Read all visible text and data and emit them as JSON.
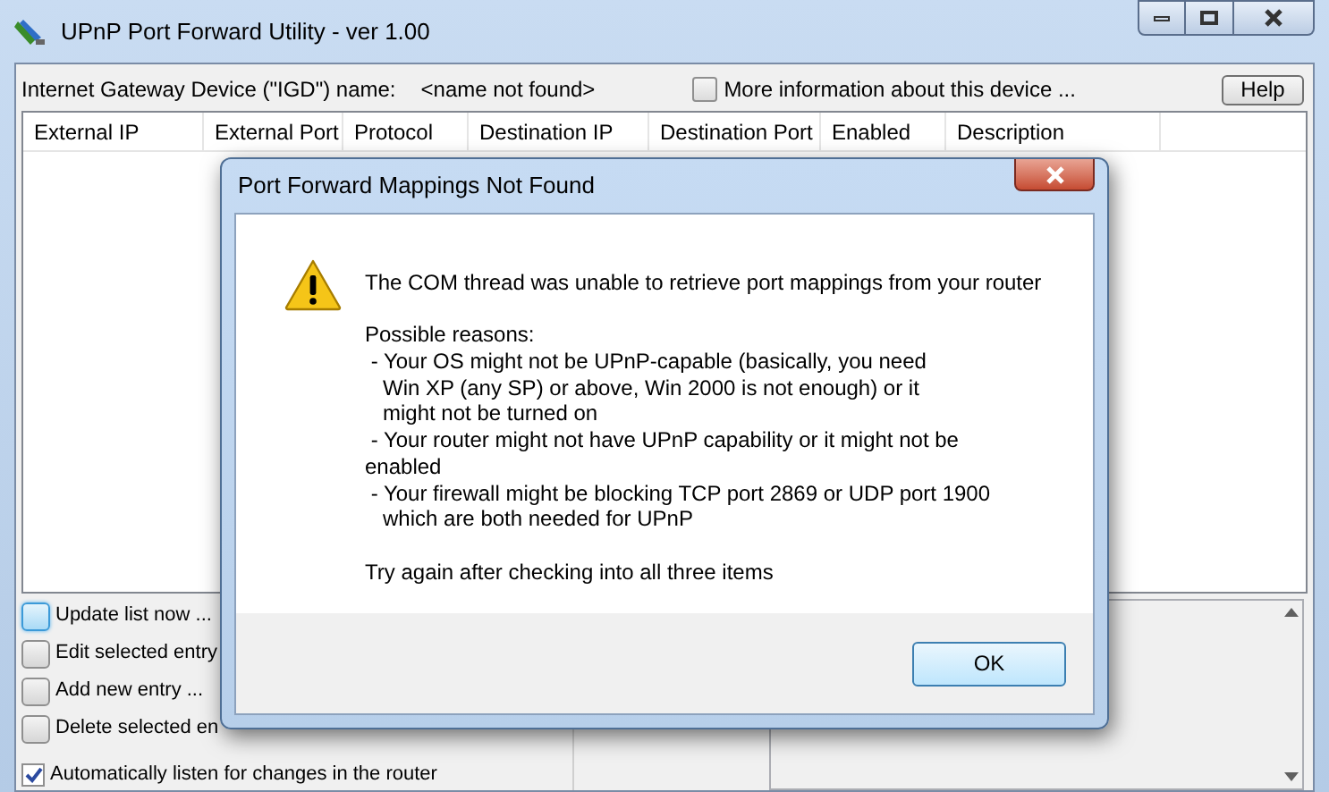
{
  "window": {
    "title": "UPnP Port Forward Utility - ver 1.00"
  },
  "igd": {
    "label": "Internet Gateway Device (\"IGD\") name:",
    "value": "<name not found>",
    "more_info": {
      "label": "More information about this device ...",
      "checked": false
    },
    "help_button": "Help"
  },
  "table": {
    "columns": [
      "External IP",
      "External Port",
      "Protocol",
      "Destination IP",
      "Destination Port",
      "Enabled",
      "Description"
    ]
  },
  "actions": [
    {
      "kind": "button",
      "label": "Update list now ...",
      "focused": true
    },
    {
      "kind": "button",
      "label": "Edit selected entry",
      "focused": false
    },
    {
      "kind": "button",
      "label": "Add new entry ...",
      "focused": false
    },
    {
      "kind": "button",
      "label": "Delete selected en",
      "focused": false
    },
    {
      "kind": "checkbox",
      "label": "Automatically listen for changes in the router",
      "checked": true
    }
  ],
  "dialog": {
    "title": "Port Forward Mappings Not Found",
    "paragraphs": [
      [
        "The COM thread was unable to retrieve port mappings from your router"
      ],
      [
        "Possible reasons:",
        " - Your OS might not be UPnP-capable (basically, you need",
        "   Win XP (any SP) or above, Win 2000 is not enough) or it",
        "   might not be turned on",
        " - Your router might not have UPnP capability or it might not be",
        "enabled",
        " - Your firewall might be blocking TCP port 2869 or UDP port 1900",
        "   which are both needed for UPnP"
      ],
      [
        "Try again after checking into all three items"
      ]
    ],
    "ok_button": "OK"
  }
}
